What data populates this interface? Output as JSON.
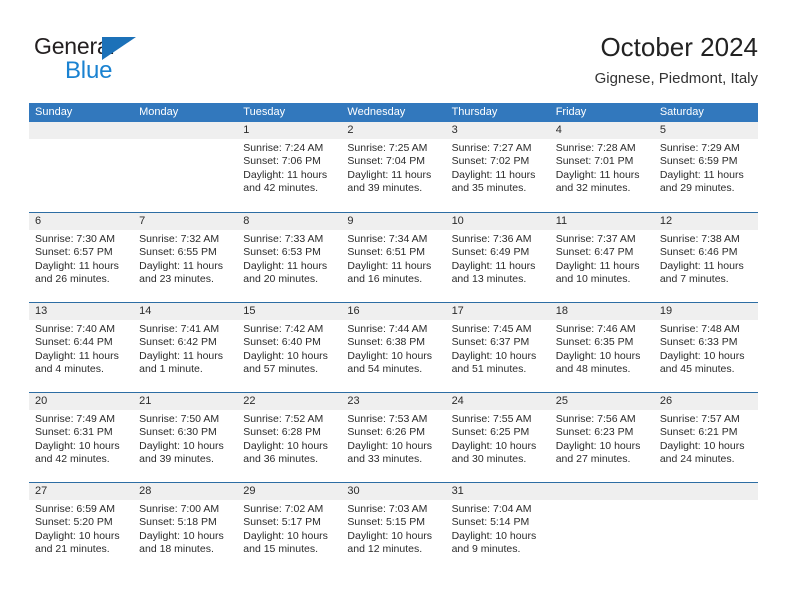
{
  "brand": {
    "word_one": "General",
    "word_two": "Blue",
    "accent_dark": "#1c71b8",
    "accent_light": "#1a82d1",
    "triangle_icon": "triangle-icon"
  },
  "header": {
    "title": "October 2024",
    "subtitle": "Gignese, Piedmont, Italy"
  },
  "theme": {
    "header_blue": "#3278bd",
    "rule_blue": "#2d6da3",
    "date_band_gray": "#efefef",
    "text": "#2b2b2b"
  },
  "weekday_headers": [
    "Sunday",
    "Monday",
    "Tuesday",
    "Wednesday",
    "Thursday",
    "Friday",
    "Saturday"
  ],
  "weeks": [
    [
      {
        "day": "",
        "lines": []
      },
      {
        "day": "",
        "lines": []
      },
      {
        "day": "1",
        "lines": [
          "Sunrise: 7:24 AM",
          "Sunset: 7:06 PM",
          "Daylight: 11 hours",
          "and 42 minutes."
        ]
      },
      {
        "day": "2",
        "lines": [
          "Sunrise: 7:25 AM",
          "Sunset: 7:04 PM",
          "Daylight: 11 hours",
          "and 39 minutes."
        ]
      },
      {
        "day": "3",
        "lines": [
          "Sunrise: 7:27 AM",
          "Sunset: 7:02 PM",
          "Daylight: 11 hours",
          "and 35 minutes."
        ]
      },
      {
        "day": "4",
        "lines": [
          "Sunrise: 7:28 AM",
          "Sunset: 7:01 PM",
          "Daylight: 11 hours",
          "and 32 minutes."
        ]
      },
      {
        "day": "5",
        "lines": [
          "Sunrise: 7:29 AM",
          "Sunset: 6:59 PM",
          "Daylight: 11 hours",
          "and 29 minutes."
        ]
      }
    ],
    [
      {
        "day": "6",
        "lines": [
          "Sunrise: 7:30 AM",
          "Sunset: 6:57 PM",
          "Daylight: 11 hours",
          "and 26 minutes."
        ]
      },
      {
        "day": "7",
        "lines": [
          "Sunrise: 7:32 AM",
          "Sunset: 6:55 PM",
          "Daylight: 11 hours",
          "and 23 minutes."
        ]
      },
      {
        "day": "8",
        "lines": [
          "Sunrise: 7:33 AM",
          "Sunset: 6:53 PM",
          "Daylight: 11 hours",
          "and 20 minutes."
        ]
      },
      {
        "day": "9",
        "lines": [
          "Sunrise: 7:34 AM",
          "Sunset: 6:51 PM",
          "Daylight: 11 hours",
          "and 16 minutes."
        ]
      },
      {
        "day": "10",
        "lines": [
          "Sunrise: 7:36 AM",
          "Sunset: 6:49 PM",
          "Daylight: 11 hours",
          "and 13 minutes."
        ]
      },
      {
        "day": "11",
        "lines": [
          "Sunrise: 7:37 AM",
          "Sunset: 6:47 PM",
          "Daylight: 11 hours",
          "and 10 minutes."
        ]
      },
      {
        "day": "12",
        "lines": [
          "Sunrise: 7:38 AM",
          "Sunset: 6:46 PM",
          "Daylight: 11 hours",
          "and 7 minutes."
        ]
      }
    ],
    [
      {
        "day": "13",
        "lines": [
          "Sunrise: 7:40 AM",
          "Sunset: 6:44 PM",
          "Daylight: 11 hours",
          "and 4 minutes."
        ]
      },
      {
        "day": "14",
        "lines": [
          "Sunrise: 7:41 AM",
          "Sunset: 6:42 PM",
          "Daylight: 11 hours",
          "and 1 minute."
        ]
      },
      {
        "day": "15",
        "lines": [
          "Sunrise: 7:42 AM",
          "Sunset: 6:40 PM",
          "Daylight: 10 hours",
          "and 57 minutes."
        ]
      },
      {
        "day": "16",
        "lines": [
          "Sunrise: 7:44 AM",
          "Sunset: 6:38 PM",
          "Daylight: 10 hours",
          "and 54 minutes."
        ]
      },
      {
        "day": "17",
        "lines": [
          "Sunrise: 7:45 AM",
          "Sunset: 6:37 PM",
          "Daylight: 10 hours",
          "and 51 minutes."
        ]
      },
      {
        "day": "18",
        "lines": [
          "Sunrise: 7:46 AM",
          "Sunset: 6:35 PM",
          "Daylight: 10 hours",
          "and 48 minutes."
        ]
      },
      {
        "day": "19",
        "lines": [
          "Sunrise: 7:48 AM",
          "Sunset: 6:33 PM",
          "Daylight: 10 hours",
          "and 45 minutes."
        ]
      }
    ],
    [
      {
        "day": "20",
        "lines": [
          "Sunrise: 7:49 AM",
          "Sunset: 6:31 PM",
          "Daylight: 10 hours",
          "and 42 minutes."
        ]
      },
      {
        "day": "21",
        "lines": [
          "Sunrise: 7:50 AM",
          "Sunset: 6:30 PM",
          "Daylight: 10 hours",
          "and 39 minutes."
        ]
      },
      {
        "day": "22",
        "lines": [
          "Sunrise: 7:52 AM",
          "Sunset: 6:28 PM",
          "Daylight: 10 hours",
          "and 36 minutes."
        ]
      },
      {
        "day": "23",
        "lines": [
          "Sunrise: 7:53 AM",
          "Sunset: 6:26 PM",
          "Daylight: 10 hours",
          "and 33 minutes."
        ]
      },
      {
        "day": "24",
        "lines": [
          "Sunrise: 7:55 AM",
          "Sunset: 6:25 PM",
          "Daylight: 10 hours",
          "and 30 minutes."
        ]
      },
      {
        "day": "25",
        "lines": [
          "Sunrise: 7:56 AM",
          "Sunset: 6:23 PM",
          "Daylight: 10 hours",
          "and 27 minutes."
        ]
      },
      {
        "day": "26",
        "lines": [
          "Sunrise: 7:57 AM",
          "Sunset: 6:21 PM",
          "Daylight: 10 hours",
          "and 24 minutes."
        ]
      }
    ],
    [
      {
        "day": "27",
        "lines": [
          "Sunrise: 6:59 AM",
          "Sunset: 5:20 PM",
          "Daylight: 10 hours",
          "and 21 minutes."
        ]
      },
      {
        "day": "28",
        "lines": [
          "Sunrise: 7:00 AM",
          "Sunset: 5:18 PM",
          "Daylight: 10 hours",
          "and 18 minutes."
        ]
      },
      {
        "day": "29",
        "lines": [
          "Sunrise: 7:02 AM",
          "Sunset: 5:17 PM",
          "Daylight: 10 hours",
          "and 15 minutes."
        ]
      },
      {
        "day": "30",
        "lines": [
          "Sunrise: 7:03 AM",
          "Sunset: 5:15 PM",
          "Daylight: 10 hours",
          "and 12 minutes."
        ]
      },
      {
        "day": "31",
        "lines": [
          "Sunrise: 7:04 AM",
          "Sunset: 5:14 PM",
          "Daylight: 10 hours",
          "and 9 minutes."
        ]
      },
      {
        "day": "",
        "lines": []
      },
      {
        "day": "",
        "lines": []
      }
    ]
  ]
}
